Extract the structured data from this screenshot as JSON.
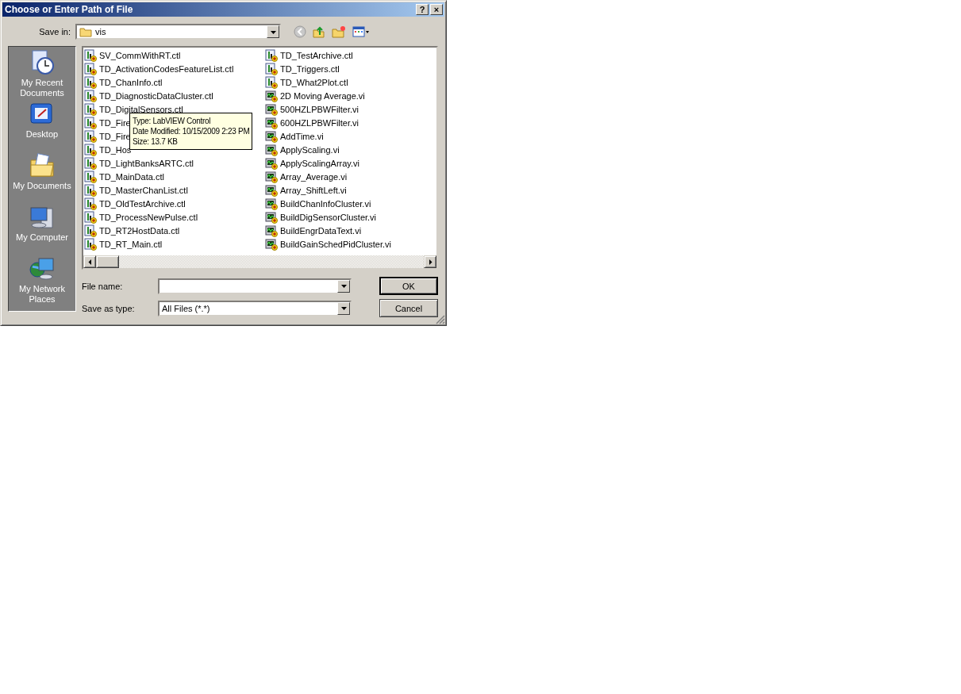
{
  "window": {
    "title": "Choose or Enter Path of File",
    "title_buttons": [
      "?",
      "×"
    ]
  },
  "save_in": {
    "label": "Save in:",
    "value": "vis"
  },
  "places": [
    {
      "label": "My Recent Documents",
      "kind": "recent"
    },
    {
      "label": "Desktop",
      "kind": "desktop"
    },
    {
      "label": "My Documents",
      "kind": "documents"
    },
    {
      "label": "My Computer",
      "kind": "computer"
    },
    {
      "label": "My Network Places",
      "kind": "network"
    }
  ],
  "files": [
    {
      "name": "SV_CommWithRT.ctl",
      "kind": "ctl"
    },
    {
      "name": "TD_ActivationCodesFeatureList.ctl",
      "kind": "ctl"
    },
    {
      "name": "TD_ChanInfo.ctl",
      "kind": "ctl"
    },
    {
      "name": "TD_DiagnosticDataCluster.ctl",
      "kind": "ctl"
    },
    {
      "name": "TD_DigitalSensors.ctl",
      "kind": "ctl"
    },
    {
      "name": "TD_Fire",
      "kind": "ctl"
    },
    {
      "name": "TD_Fire",
      "kind": "ctl"
    },
    {
      "name": "TD_Hos",
      "kind": "ctl"
    },
    {
      "name": "TD_LightBanksARTC.ctl",
      "kind": "ctl"
    },
    {
      "name": "TD_MainData.ctl",
      "kind": "ctl"
    },
    {
      "name": "TD_MasterChanList.ctl",
      "kind": "ctl"
    },
    {
      "name": "TD_OldTestArchive.ctl",
      "kind": "ctl"
    },
    {
      "name": "TD_ProcessNewPulse.ctl",
      "kind": "ctl"
    },
    {
      "name": "TD_RT2HostData.ctl",
      "kind": "ctl"
    },
    {
      "name": "TD_RT_Main.ctl",
      "kind": "ctl"
    },
    {
      "name": "TD_TestArchive.ctl",
      "kind": "ctl"
    },
    {
      "name": "TD_Triggers.ctl",
      "kind": "ctl"
    },
    {
      "name": "TD_What2Plot.ctl",
      "kind": "ctl"
    },
    {
      "name": "2D Moving Average.vi",
      "kind": "vi"
    },
    {
      "name": "500HZLPBWFilter.vi",
      "kind": "vi"
    },
    {
      "name": "600HZLPBWFilter.vi",
      "kind": "vi"
    },
    {
      "name": "AddTime.vi",
      "kind": "vi"
    },
    {
      "name": "ApplyScaling.vi",
      "kind": "vi"
    },
    {
      "name": "ApplyScalingArray.vi",
      "kind": "vi"
    },
    {
      "name": "Array_Average.vi",
      "kind": "vi"
    },
    {
      "name": "Array_ShiftLeft.vi",
      "kind": "vi"
    },
    {
      "name": "BuildChanInfoCluster.vi",
      "kind": "vi"
    },
    {
      "name": "BuildDigSensorCluster.vi",
      "kind": "vi"
    },
    {
      "name": "BuildEngrDataText.vi",
      "kind": "vi"
    },
    {
      "name": "BuildGainSchedPidCluster.vi",
      "kind": "vi"
    }
  ],
  "tooltip": {
    "lines": [
      "Type: LabVIEW Control",
      "Date Modified: 10/15/2009 2:23 PM",
      "Size: 13.7 KB"
    ]
  },
  "file_name": {
    "label": "File name:"
  },
  "save_as_type": {
    "label": "Save as type:",
    "value": "All Files (*.*)"
  },
  "buttons": [
    {
      "label": "OK",
      "default": true
    },
    {
      "label": "Cancel",
      "default": false
    }
  ]
}
